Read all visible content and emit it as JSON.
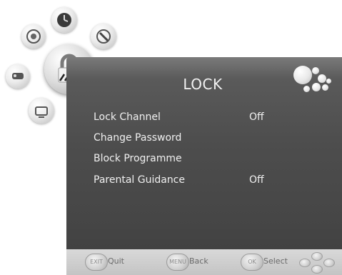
{
  "menu": {
    "title": "LOCK",
    "items": [
      {
        "label": "Lock Channel",
        "value": "Off"
      },
      {
        "label": "Change Password",
        "value": ""
      },
      {
        "label": "Block Programme",
        "value": ""
      },
      {
        "label": "Parental Guidance",
        "value": "Off"
      }
    ],
    "selected_category": "lock"
  },
  "categories": [
    {
      "name": "picture-icon"
    },
    {
      "name": "clock-icon"
    },
    {
      "name": "setup-icon"
    },
    {
      "name": "sound-icon"
    },
    {
      "name": "lock-icon"
    },
    {
      "name": "channel-icon"
    }
  ],
  "bottom_bar": {
    "quit": {
      "key": "EXIT",
      "label": "Quit"
    },
    "back": {
      "key": "MENU",
      "label": "Back"
    },
    "select": {
      "key": "OK",
      "label": "Select"
    }
  },
  "colors": {
    "panel": "#4d4d4d",
    "text": "#f0f0f0",
    "bar": "#cccccc"
  }
}
